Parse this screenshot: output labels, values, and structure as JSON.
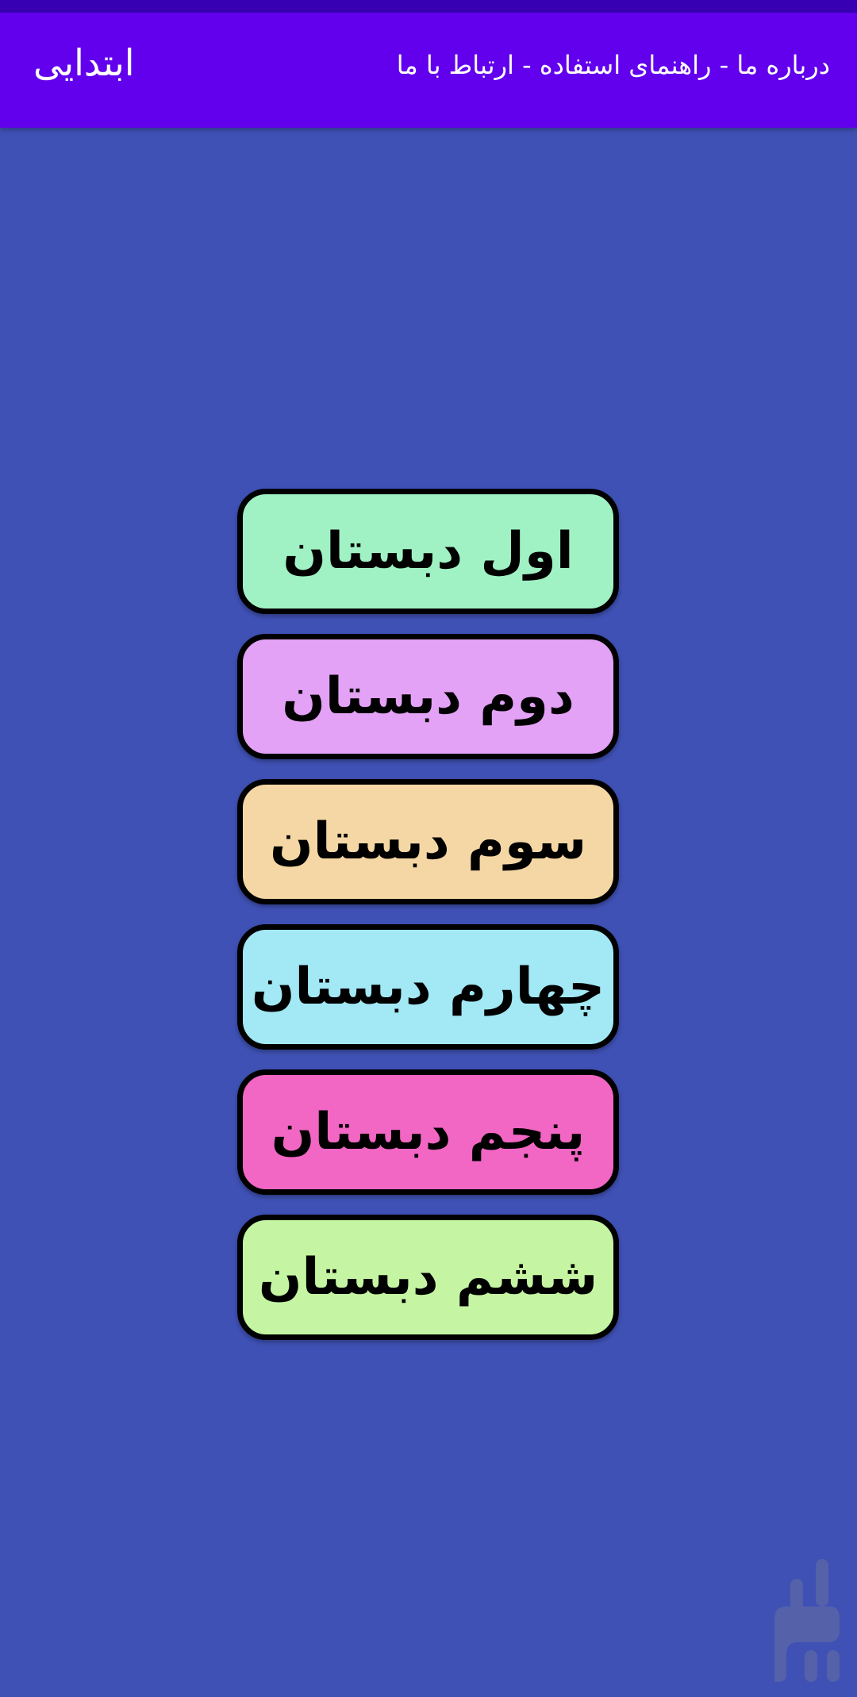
{
  "app_bar": {
    "title": "ابتدایی",
    "menu": "درباره ما - راهنمای استفاده - ارتباط با ما"
  },
  "grades": [
    {
      "label": "اول دبستان",
      "color": "#A0F2C4"
    },
    {
      "label": "دوم دبستان",
      "color": "#E3A2F5"
    },
    {
      "label": "سوم دبستان",
      "color": "#F5D7A5"
    },
    {
      "label": "چهارم دبستان",
      "color": "#A2E8F5"
    },
    {
      "label": "پنجم دبستان",
      "color": "#F266C4"
    },
    {
      "label": "ششم دبستان",
      "color": "#C5F5A2"
    }
  ],
  "watermark": {
    "icon": "bazaar-logo-icon",
    "color": "#5A64A8"
  }
}
